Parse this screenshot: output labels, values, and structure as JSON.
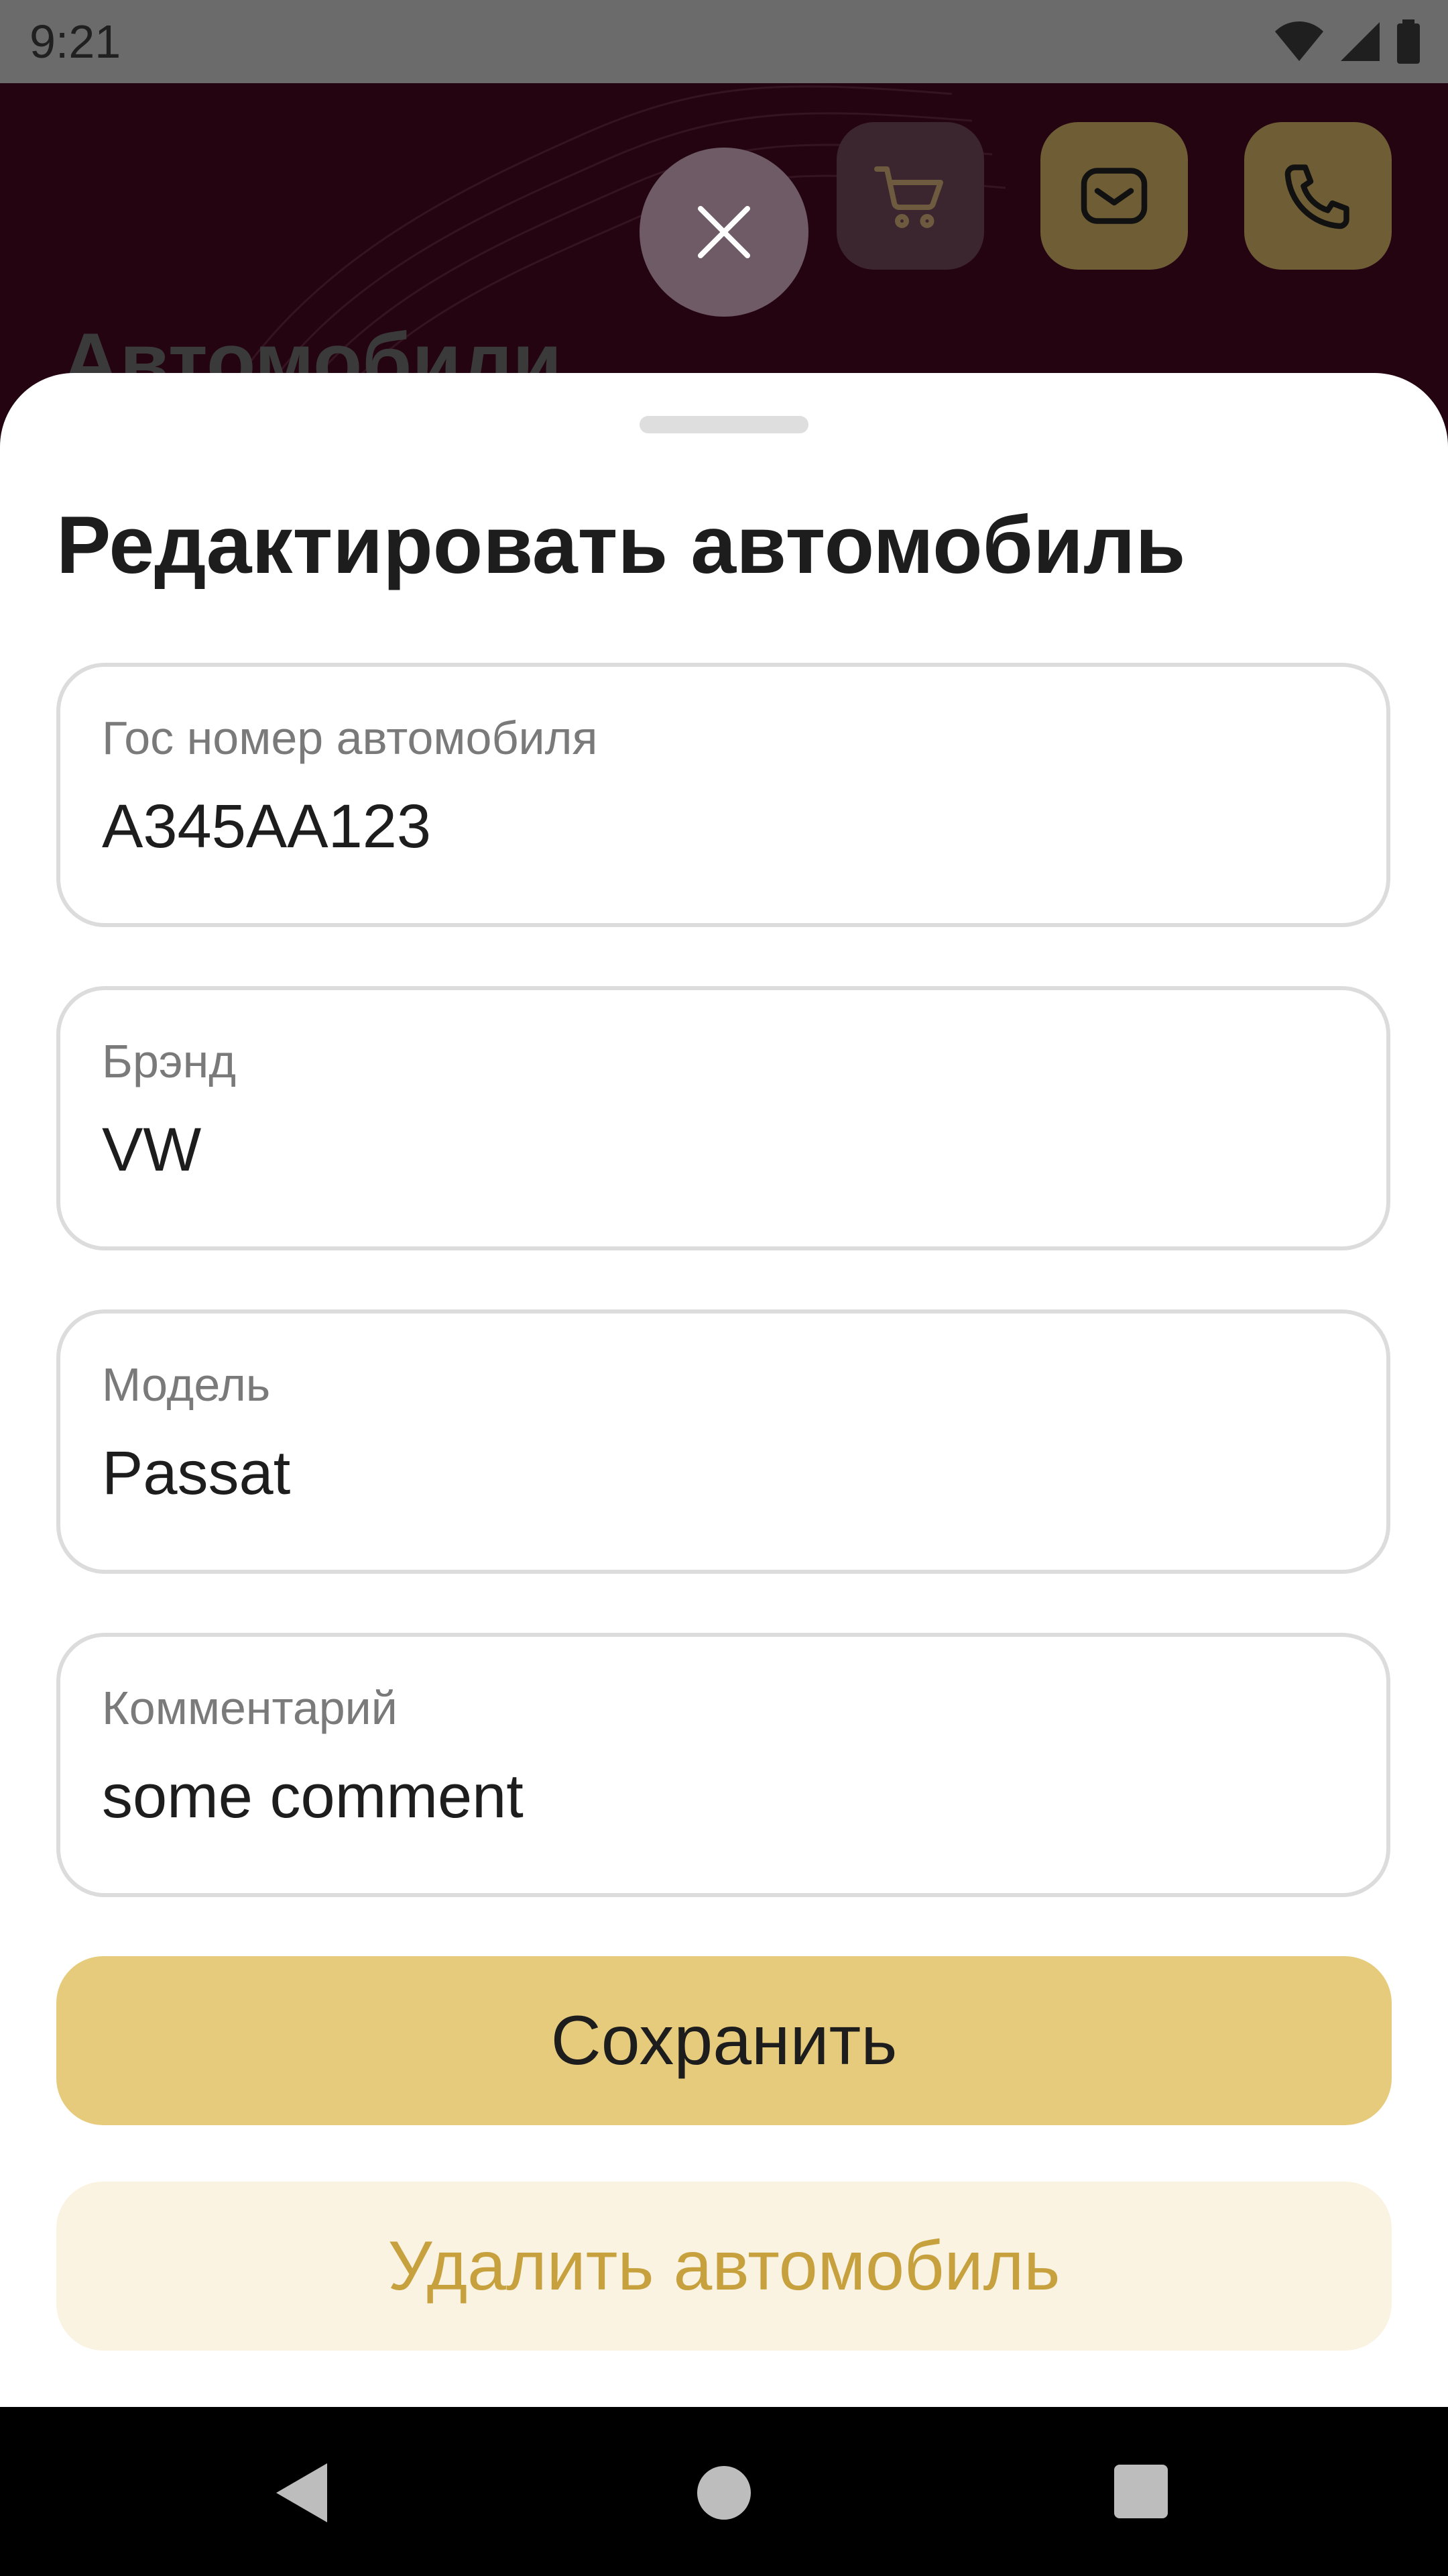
{
  "status_bar": {
    "time": "9:21",
    "icons": [
      "wifi-icon",
      "signal-icon",
      "battery-icon"
    ]
  },
  "background_screen": {
    "title": "Автомобили",
    "actions": [
      "cart-icon",
      "mail-icon",
      "phone-icon"
    ],
    "colors": {
      "header_bg": "#250412",
      "accent": "#e7cb7c"
    }
  },
  "sheet": {
    "title": "Редактировать автомобиль",
    "fields": [
      {
        "label": "Гос номер автомобиля",
        "value": "А345АА123"
      },
      {
        "label": "Брэнд",
        "value": "VW"
      },
      {
        "label": "Модель",
        "value": "Passat"
      },
      {
        "label": "Комментарий",
        "value": "some comment"
      }
    ],
    "save_label": "Сохранить",
    "delete_label": "Удалить автомобиль",
    "colors": {
      "save_bg": "#e7cb7c",
      "delete_bg": "#fbf3e2",
      "delete_text": "#c7a13e"
    }
  },
  "nav_bar": {
    "icons": [
      "back-icon",
      "home-icon",
      "recents-icon"
    ]
  }
}
